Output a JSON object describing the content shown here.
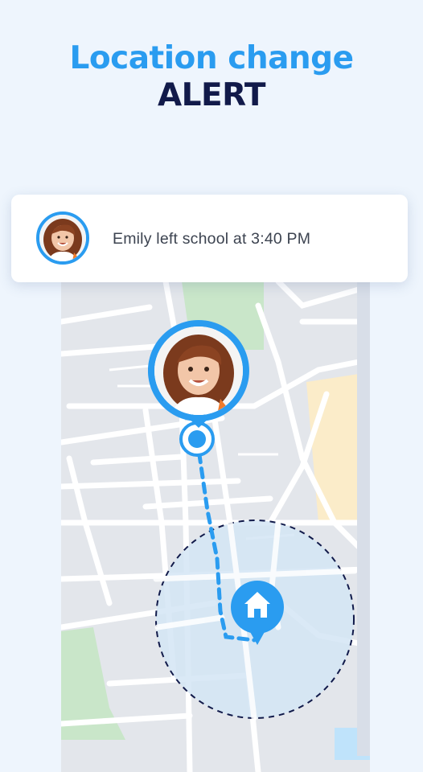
{
  "headline": {
    "line1": "Location change",
    "line2": "ALERT"
  },
  "notification": {
    "message": "Emily left school at 3:40 PM",
    "avatar_icon": "child-avatar"
  },
  "map": {
    "child_marker_icon": "child-avatar",
    "home_icon": "home-icon",
    "colors": {
      "accent": "#2a9cf0",
      "geofence": "#111a4a",
      "park": "#c9e6c9",
      "water": "#bfe3fb",
      "sand": "#fbecc9"
    }
  }
}
